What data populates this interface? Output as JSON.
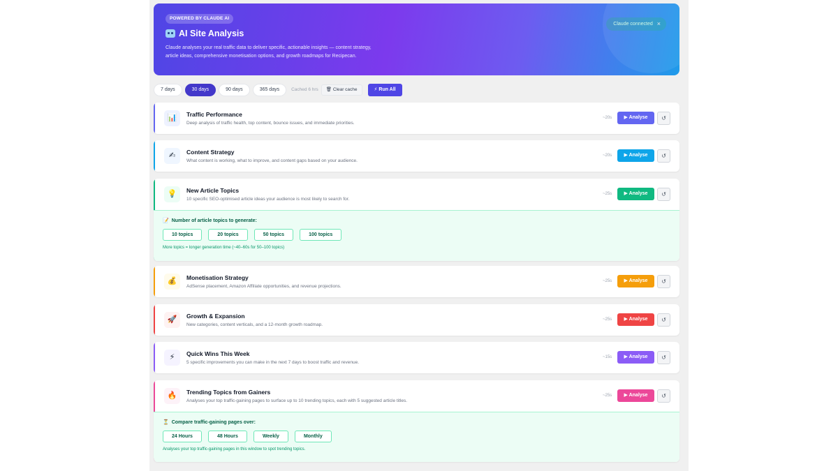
{
  "hero": {
    "badge": "POWERED BY CLAUDE AI",
    "icon": "robot-icon",
    "title": "AI Site Analysis",
    "description": "Claude analyses your real traffic data to deliver specific, actionable insights — content strategy, article ideas, comprehensive monetisation options, and growth roadmaps for Recipecan.",
    "connected_label": "Claude connected",
    "connected_close": "×"
  },
  "toolbar": {
    "ranges": [
      {
        "label": "7 days",
        "active": false
      },
      {
        "label": "30 days",
        "active": true
      },
      {
        "label": "90 days",
        "active": false
      },
      {
        "label": "365 days",
        "active": false
      }
    ],
    "cached": "Cached 6 hrs",
    "clear_cache": "🗑 Clear cache",
    "run_all": "⚡ Run All"
  },
  "cards": [
    {
      "title": "Traffic Performance",
      "desc": "Deep analysis of traffic health, top content, bounce issues, and immediate priorities.",
      "est": "~20s",
      "icon": "📊",
      "icon_name": "bar-chart-icon",
      "color": "#6366f1",
      "icon_bg": "#eef2ff"
    },
    {
      "title": "Content Strategy",
      "desc": "What content is working, what to improve, and content gaps based on your audience.",
      "est": "~20s",
      "icon": "✍",
      "icon_name": "writing-hand-icon",
      "color": "#0ea5e9",
      "icon_bg": "#eff6ff"
    },
    {
      "title": "New Article Topics",
      "desc": "10 specific SEO-optimised article ideas your audience is most likely to search for.",
      "est": "~25s",
      "icon": "💡",
      "icon_name": "lightbulb-icon",
      "color": "#10b981",
      "icon_bg": "#ecfdf5"
    },
    {
      "title": "Monetisation Strategy",
      "desc": "AdSense placement, Amazon Affiliate opportunities, and revenue projections.",
      "est": "~25s",
      "icon": "💰",
      "icon_name": "money-bag-icon",
      "color": "#f59e0b",
      "icon_bg": "#fffbeb"
    },
    {
      "title": "Growth & Expansion",
      "desc": "New categories, content verticals, and a 12-month growth roadmap.",
      "est": "~25s",
      "icon": "🚀",
      "icon_name": "rocket-icon",
      "color": "#ef4444",
      "icon_bg": "#fef2f2"
    },
    {
      "title": "Quick Wins This Week",
      "desc": "5 specific improvements you can make in the next 7 days to boost traffic and revenue.",
      "est": "~15s",
      "icon": "⚡",
      "icon_name": "lightning-icon",
      "color": "#8b5cf6",
      "icon_bg": "#f5f3ff"
    },
    {
      "title": "Trending Topics from Gainers",
      "desc": "Analyses your top traffic-gaining pages to surface up to 10 trending topics, each with 5 suggested article titles.",
      "est": "~25s",
      "icon": "🔥",
      "icon_name": "fire-icon",
      "color": "#ec4899",
      "icon_bg": "#fdf2f8"
    }
  ],
  "analyse_label": "▶ Analyse",
  "refresh_glyph": "↺",
  "topics_options": {
    "label": "Number of article topics to generate:",
    "icon": "📝",
    "chips": [
      "10 topics",
      "20 topics",
      "50 topics",
      "100 topics"
    ],
    "note": "More topics = longer generation time (~40–60s for 50–100 topics)"
  },
  "trending_options": {
    "label": "Compare traffic-gaining pages over:",
    "icon": "⏳",
    "chips": [
      "24 Hours",
      "48 Hours",
      "Weekly",
      "Monthly"
    ],
    "note": "Analyses your top traffic-gaining pages in this window to spot trending topics."
  }
}
